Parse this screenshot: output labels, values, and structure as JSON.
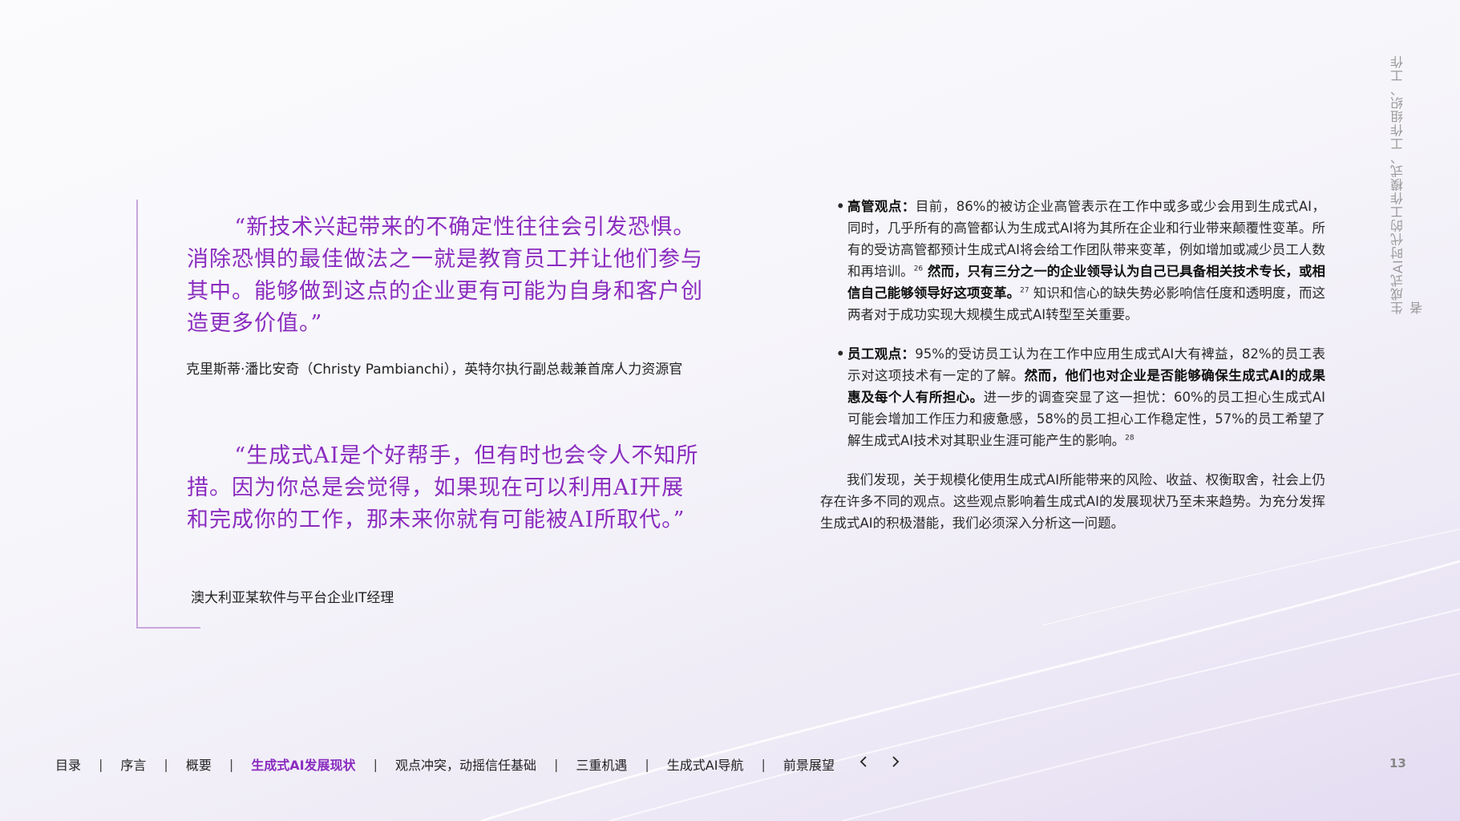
{
  "side_title": "生成式AI时代的工作模式、工作组织、工作者",
  "quotes": [
    {
      "text": "“新技术兴起带来的不确定性往往会引发恐惧。消除恐惧的最佳做法之一就是教育员工并让他们参与其中。能够做到这点的企业更有可能为自身和客户创造更多价值。”",
      "attribution": "克里斯蒂·潘比安奇（Christy Pambianchi），英特尔执行副总裁兼首席人力资源官"
    },
    {
      "text": "“生成式AI是个好帮手，但有时也会令人不知所措。因为你总是会觉得，如果现在可以利用AI开展和完成你的工作，那未来你就有可能被AI所取代。”",
      "attribution": "澳大利亚某软件与平台企业IT经理"
    }
  ],
  "bullets": [
    {
      "marker": "•",
      "label": "高管观点：",
      "text1": "目前，86%的被访企业高管表示在工作中或多或少会用到生成式AI，同时，几乎所有的高管都认为生成式AI将为其所在企业和行业带来颠覆性变革。所有的受访高管都预计生成式AI将会给工作团队带来变革，例如增加或减少员工人数和再培训。",
      "sup1": "26",
      "bold1": " 然而，只有三分之一的企业领导认为自己已具备相关技术专长，或相信自己能够领导好这项变革。",
      "sup2": "27",
      "text2": " 知识和信心的缺失势必影响信任度和透明度，而这两者对于成功实现大规模生成式AI转型至关重要。"
    },
    {
      "marker": "•",
      "label": "员工观点：",
      "text1": "95%的受访员工认为在工作中应用生成式AI大有裨益，82%的员工表示对这项技术有一定的了解。",
      "bold1": "然而，他们也对企业是否能够确保生成式AI的成果惠及每个人有所担心。",
      "text2": "进一步的调查突显了这一担忧：60%的员工担心生成式AI可能会增加工作压力和疲惫感，58%的员工担心工作稳定性，57%的员工希望了解生成式AI技术对其职业生涯可能产生的影响。",
      "sup1": "28"
    }
  ],
  "paragraph": "我们发现，关于规模化使用生成式AI所能带来的风险、收益、权衡取舍，社会上仍存在许多不同的观点。这些观点影响着生成式AI的发展现状乃至未来趋势。为充分发挥生成式AI的积极潜能，我们必须深入分析这一问题。",
  "nav": {
    "items": [
      "目录",
      "序言",
      "概要",
      "生成式AI发展现状",
      "观点冲突，动摇信任基础",
      "三重机遇",
      "生成式AI导航",
      "前景展望"
    ],
    "separator": "|",
    "prev_icon": "chevron-left-icon",
    "next_icon": "chevron-right-icon"
  },
  "page_number": "13",
  "colors": {
    "accent": "#8a2cbf",
    "frame": "#c9a6db"
  }
}
